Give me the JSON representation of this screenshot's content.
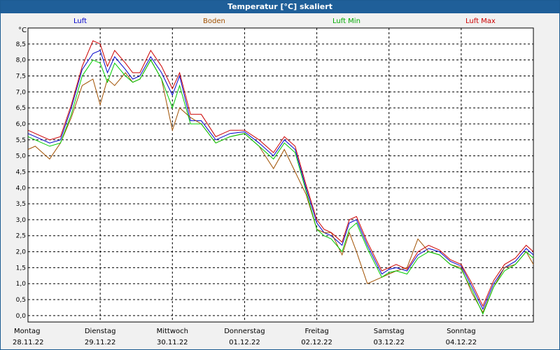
{
  "window": {
    "title": "Temperatur [°C] skaliert"
  },
  "chart_data": {
    "type": "line",
    "title": "Temperatur [°C] skaliert",
    "ylabel": "°C",
    "ylim": [
      -0.2,
      9.0
    ],
    "yticks": [
      "0,0",
      "0,5",
      "1,0",
      "1,5",
      "2,0",
      "2,5",
      "3,0",
      "3,5",
      "4,0",
      "4,5",
      "5,0",
      "5,5",
      "6,0",
      "6,5",
      "7,0",
      "7,5",
      "8,0",
      "8,5"
    ],
    "ytick_values": [
      0,
      0.5,
      1,
      1.5,
      2,
      2.5,
      3,
      3.5,
      4,
      4.5,
      5,
      5.5,
      6,
      6.5,
      7,
      7.5,
      8,
      8.5
    ],
    "x_start_label": "Montag 28.11.22",
    "x_categories": [
      {
        "day": "Montag",
        "date": "28.11.22"
      },
      {
        "day": "Dienstag",
        "date": "29.11.22"
      },
      {
        "day": "Mittwoch",
        "date": "30.11.22"
      },
      {
        "day": "Donnerstag",
        "date": "01.12.22"
      },
      {
        "day": "Freitag",
        "date": "02.12.22"
      },
      {
        "day": "Samstag",
        "date": "03.12.22"
      },
      {
        "day": "Sonntag",
        "date": "04.12.22"
      }
    ],
    "x_range_days": [
      0,
      7
    ],
    "grid": true,
    "legend_position": "top",
    "series": [
      {
        "name": "Luft",
        "color": "#0000cc",
        "x": [
          0,
          0.1,
          0.3,
          0.45,
          0.6,
          0.75,
          0.9,
          1.0,
          1.1,
          1.2,
          1.35,
          1.45,
          1.55,
          1.7,
          1.85,
          2.0,
          2.1,
          2.25,
          2.4,
          2.6,
          2.8,
          3.0,
          3.2,
          3.4,
          3.55,
          3.7,
          3.85,
          4.0,
          4.1,
          4.2,
          4.35,
          4.45,
          4.55,
          4.7,
          4.9,
          5.0,
          5.1,
          5.25,
          5.4,
          5.55,
          5.7,
          5.85,
          6.0,
          6.15,
          6.3,
          6.45,
          6.6,
          6.75,
          6.9,
          7.0
        ],
        "values": [
          5.7,
          5.6,
          5.4,
          5.5,
          6.5,
          7.7,
          8.2,
          8.3,
          7.6,
          8.1,
          7.7,
          7.4,
          7.5,
          8.1,
          7.6,
          6.9,
          7.5,
          6.1,
          6.1,
          5.5,
          5.7,
          5.75,
          5.4,
          5.0,
          5.5,
          5.2,
          4.0,
          2.9,
          2.6,
          2.5,
          2.2,
          2.9,
          3.0,
          2.2,
          1.3,
          1.45,
          1.5,
          1.4,
          1.9,
          2.1,
          2.0,
          1.7,
          1.55,
          0.9,
          0.2,
          1.0,
          1.5,
          1.7,
          2.1,
          1.9
        ]
      },
      {
        "name": "Boden",
        "color": "#a05000",
        "x": [
          0,
          0.1,
          0.3,
          0.45,
          0.6,
          0.75,
          0.9,
          1.0,
          1.1,
          1.2,
          1.35,
          1.45,
          1.55,
          1.7,
          1.85,
          2.0,
          2.1,
          2.25,
          2.4,
          2.6,
          2.8,
          3.0,
          3.2,
          3.4,
          3.55,
          3.7,
          3.85,
          4.0,
          4.1,
          4.2,
          4.35,
          4.45,
          4.55,
          4.7,
          4.9,
          5.0,
          5.1,
          5.25,
          5.4,
          5.55,
          5.7,
          5.85,
          6.0,
          6.15,
          6.3,
          6.45,
          6.6,
          6.75,
          6.9,
          7.0
        ],
        "values": [
          5.2,
          5.3,
          4.9,
          5.4,
          6.2,
          7.2,
          7.4,
          6.6,
          7.4,
          7.2,
          7.6,
          7.3,
          7.4,
          8.0,
          7.4,
          5.8,
          6.5,
          6.2,
          6.0,
          5.4,
          5.6,
          5.7,
          5.3,
          4.6,
          5.2,
          4.5,
          3.8,
          2.7,
          2.6,
          2.6,
          1.9,
          2.6,
          2.0,
          1.0,
          1.2,
          1.3,
          1.4,
          1.5,
          2.4,
          2.0,
          1.9,
          1.6,
          1.5,
          0.7,
          0.1,
          0.9,
          1.5,
          1.6,
          2.0,
          1.6
        ]
      },
      {
        "name": "Luft Min",
        "color": "#00cc00",
        "x": [
          0,
          0.1,
          0.3,
          0.45,
          0.6,
          0.75,
          0.9,
          1.0,
          1.1,
          1.2,
          1.35,
          1.45,
          1.55,
          1.7,
          1.85,
          2.0,
          2.1,
          2.25,
          2.4,
          2.6,
          2.8,
          3.0,
          3.2,
          3.4,
          3.55,
          3.7,
          3.85,
          4.0,
          4.1,
          4.2,
          4.35,
          4.45,
          4.55,
          4.7,
          4.9,
          5.0,
          5.1,
          5.25,
          5.4,
          5.55,
          5.7,
          5.85,
          6.0,
          6.15,
          6.3,
          6.45,
          6.6,
          6.75,
          6.9,
          7.0
        ],
        "values": [
          5.6,
          5.5,
          5.3,
          5.4,
          6.3,
          7.5,
          8.0,
          7.9,
          7.3,
          7.9,
          7.5,
          7.3,
          7.4,
          8.0,
          7.4,
          6.5,
          7.2,
          6.0,
          6.0,
          5.4,
          5.6,
          5.7,
          5.3,
          4.9,
          5.4,
          5.1,
          3.9,
          2.7,
          2.5,
          2.4,
          2.0,
          2.7,
          2.9,
          2.1,
          1.2,
          1.35,
          1.4,
          1.3,
          1.8,
          2.0,
          1.9,
          1.6,
          1.45,
          0.8,
          0.05,
          0.9,
          1.4,
          1.6,
          2.0,
          1.8
        ]
      },
      {
        "name": "Luft Max",
        "color": "#cc0000",
        "x": [
          0,
          0.1,
          0.3,
          0.45,
          0.6,
          0.75,
          0.9,
          1.0,
          1.1,
          1.2,
          1.35,
          1.45,
          1.55,
          1.7,
          1.85,
          2.0,
          2.1,
          2.25,
          2.4,
          2.6,
          2.8,
          3.0,
          3.2,
          3.4,
          3.55,
          3.7,
          3.85,
          4.0,
          4.1,
          4.2,
          4.35,
          4.45,
          4.55,
          4.7,
          4.9,
          5.0,
          5.1,
          5.25,
          5.4,
          5.55,
          5.7,
          5.85,
          6.0,
          6.15,
          6.3,
          6.45,
          6.6,
          6.75,
          6.9,
          7.0
        ],
        "values": [
          5.8,
          5.7,
          5.5,
          5.6,
          6.6,
          7.8,
          8.6,
          8.5,
          7.8,
          8.3,
          7.9,
          7.6,
          7.6,
          8.3,
          7.8,
          7.1,
          7.6,
          6.3,
          6.3,
          5.6,
          5.8,
          5.8,
          5.5,
          5.1,
          5.6,
          5.3,
          4.1,
          3.0,
          2.7,
          2.6,
          2.3,
          3.0,
          3.1,
          2.3,
          1.4,
          1.5,
          1.6,
          1.45,
          2.0,
          2.2,
          2.05,
          1.75,
          1.6,
          1.0,
          0.3,
          1.1,
          1.6,
          1.8,
          2.2,
          2.0
        ]
      }
    ]
  }
}
